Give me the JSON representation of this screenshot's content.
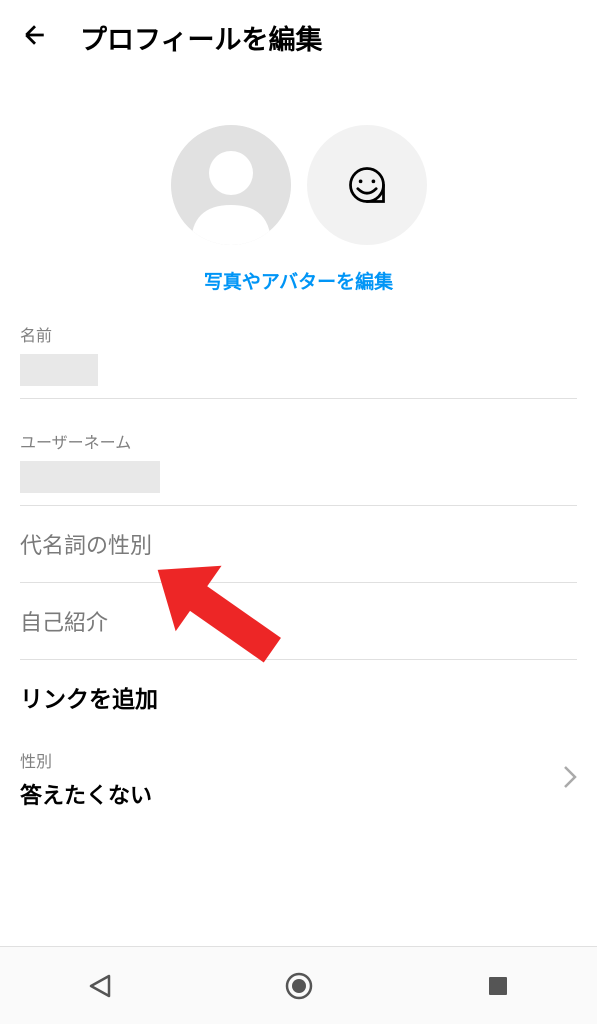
{
  "header": {
    "title": "プロフィールを編集"
  },
  "avatar": {
    "edit_link": "写真やアバターを編集"
  },
  "fields": {
    "name": {
      "label": "名前",
      "value": ""
    },
    "username": {
      "label": "ユーザーネーム",
      "value": ""
    },
    "pronoun": {
      "label": "代名詞の性別"
    },
    "bio": {
      "label": "自己紹介"
    },
    "links": {
      "label": "リンクを追加"
    },
    "gender": {
      "label": "性別",
      "value": "答えたくない"
    }
  },
  "colors": {
    "accent": "#0095f6",
    "arrow": "#ed2626"
  }
}
